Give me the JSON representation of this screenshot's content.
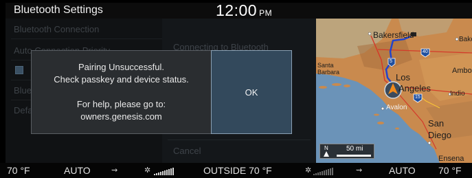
{
  "header": {
    "title": "Bluetooth Settings",
    "time": "12:00",
    "ampm": "PM"
  },
  "settings": {
    "items": [
      {
        "label": "Bluetooth Connection"
      },
      {
        "label": "Auto Connection Priority"
      },
      {
        "label": ""
      },
      {
        "label": "Blue"
      },
      {
        "label": "Defa"
      }
    ],
    "connecting_text": "Connecting to Bluetooth",
    "cancel_label": "Cancel"
  },
  "dialog": {
    "line1": "Pairing Unsuccessful.",
    "line2": "Check passkey and device status.",
    "line3": "For help, please go to:",
    "line4": "owners.genesis.com",
    "ok_label": "OK"
  },
  "map": {
    "labels": {
      "bakersfield": "Bakersfield",
      "bake": "Bake",
      "santa_barbara_1": "Santa",
      "santa_barbara_2": "Barbara",
      "ambo": "Ambo",
      "los": "Los",
      "angeles": "Angeles",
      "indio": "Indio",
      "avalon": "Avalon",
      "san": "San",
      "diego": "Diego",
      "ensena": "Ensena"
    },
    "shields": {
      "i5": "5",
      "i40": "40",
      "i15": "15"
    },
    "scale": {
      "north": "N",
      "distance": "50 mi"
    },
    "colors": {
      "water": "#6b93b8",
      "land": "#c98a4e",
      "route": "#2244cc"
    }
  },
  "climate": {
    "left_temp": "70 °F",
    "left_mode": "AUTO",
    "outside": "OUTSIDE  70 °F",
    "right_mode": "AUTO",
    "right_temp": "70 °F"
  }
}
